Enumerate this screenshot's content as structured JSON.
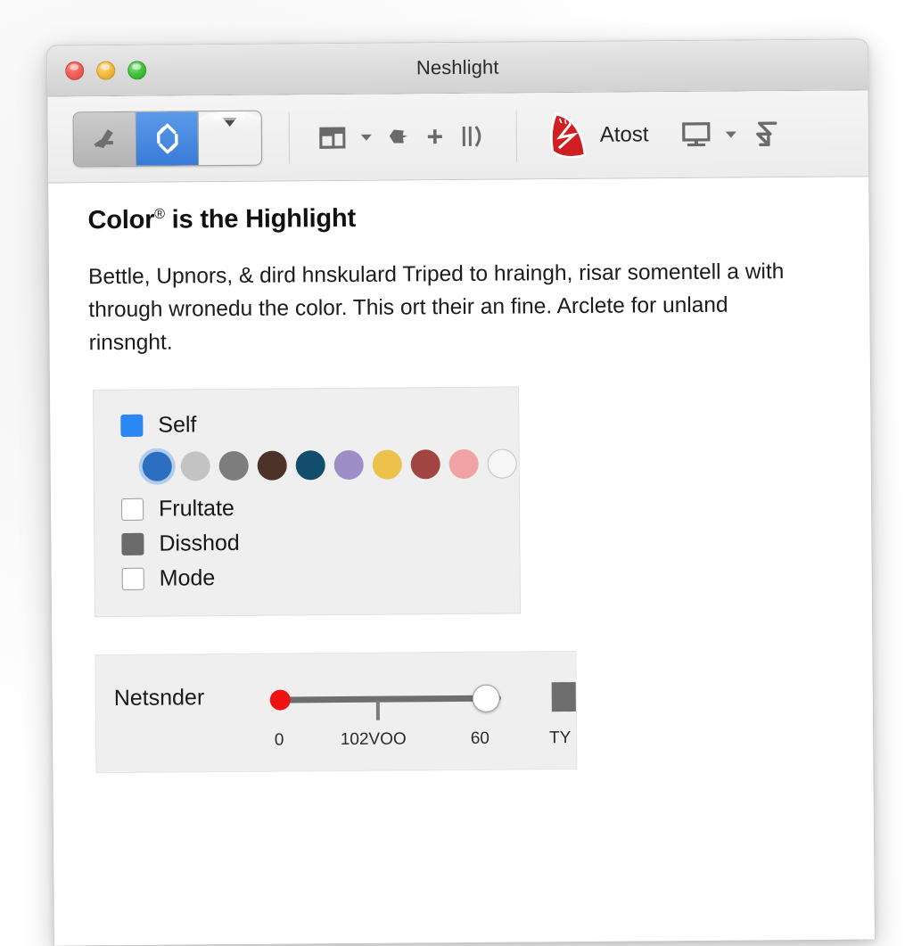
{
  "window": {
    "title": "Neshlight",
    "traffic_lights": [
      "close",
      "minimize",
      "maximize"
    ]
  },
  "toolbar": {
    "segmented": [
      {
        "icon": "flag-tool-icon",
        "state": "normal",
        "style": "gray"
      },
      {
        "icon": "diamond-brackets-icon",
        "state": "selected",
        "style": "blue"
      },
      {
        "icon": "chevron-down-icon",
        "state": "normal",
        "style": "light"
      }
    ],
    "items": [
      {
        "icon": "window-layout-icon"
      },
      {
        "icon": "chevron-down-icon"
      },
      {
        "icon": "blob-shape-icon"
      },
      {
        "icon": "plus-icon"
      },
      {
        "icon": "columns-panel-icon"
      }
    ],
    "atost": {
      "icon": "red-sail-icon",
      "label": "Atost",
      "accent": "#cf1f22"
    },
    "right_items": [
      {
        "icon": "monitor-icon"
      },
      {
        "icon": "chevron-down-icon"
      },
      {
        "icon": "zigzag-arrow-icon"
      }
    ]
  },
  "content": {
    "heading": "Color",
    "heading_mark": "®",
    "heading_tail": " is the Highlight",
    "paragraph": "Bettle, Upnors, & dird hnskulard Triped to hraingh, risar somentell a with through wronedu the color. This ort their an fine. Arclete for unland rinsnght."
  },
  "options": {
    "rows": [
      {
        "label": "Self",
        "checkbox": "blue",
        "checked": true
      },
      {
        "label": "Frultate",
        "checkbox": "empty",
        "checked": false
      },
      {
        "label": "Disshod",
        "checkbox": "filled",
        "checked": true
      },
      {
        "label": "Mode",
        "checkbox": "empty",
        "checked": false
      }
    ],
    "swatches": [
      {
        "name": "blue",
        "color": "#2c6ec0",
        "selected": true
      },
      {
        "name": "light-gray",
        "color": "#c3c3c3",
        "selected": false
      },
      {
        "name": "gray",
        "color": "#7d7d7d",
        "selected": false
      },
      {
        "name": "brown",
        "color": "#4d322a",
        "selected": false
      },
      {
        "name": "teal-blue",
        "color": "#134d6e",
        "selected": false
      },
      {
        "name": "purple",
        "color": "#9c8ec6",
        "selected": false
      },
      {
        "name": "gold",
        "color": "#edc24a",
        "selected": false
      },
      {
        "name": "dark-red",
        "color": "#a04542",
        "selected": false
      },
      {
        "name": "pink",
        "color": "#f0a3a5",
        "selected": false
      },
      {
        "name": "none",
        "color": "",
        "selected": false,
        "outline": true
      }
    ]
  },
  "slider": {
    "label": "Netsnder",
    "min_label": "0",
    "mid_label": "102VOO",
    "max_label": "60",
    "end_label": "TY",
    "min_knob_color": "#ef1212",
    "value_position_pct": 100,
    "tick_position_pct": 46
  }
}
